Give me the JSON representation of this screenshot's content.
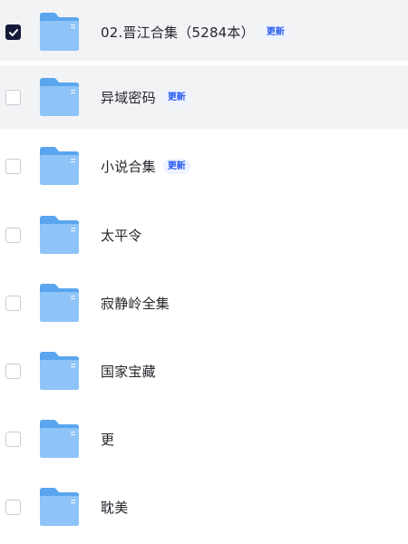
{
  "files": [
    {
      "name": "02.晋江合集（5284本）",
      "badge": "更新",
      "checked": true,
      "state": "selected"
    },
    {
      "name": "异域密码",
      "badge": "更新",
      "checked": false,
      "state": "hover"
    },
    {
      "name": "小说合集",
      "badge": "更新",
      "checked": false,
      "state": "normal"
    },
    {
      "name": "太平令",
      "badge": "",
      "checked": false,
      "state": "normal"
    },
    {
      "name": "寂静岭全集",
      "badge": "",
      "checked": false,
      "state": "normal"
    },
    {
      "name": "国家宝藏",
      "badge": "",
      "checked": false,
      "state": "normal"
    },
    {
      "name": "更",
      "badge": "",
      "checked": false,
      "state": "normal"
    },
    {
      "name": "耽美",
      "badge": "",
      "checked": false,
      "state": "normal"
    }
  ],
  "colors": {
    "folder_back": "#5aa6ee",
    "folder_front": "#8ec4f8",
    "badge_text": "#2a5cf0",
    "checkbox_checked": "#161a3a",
    "row_highlight": "#f2f3f5"
  },
  "icons": {
    "folder": "folder-icon",
    "check": "check-icon"
  }
}
